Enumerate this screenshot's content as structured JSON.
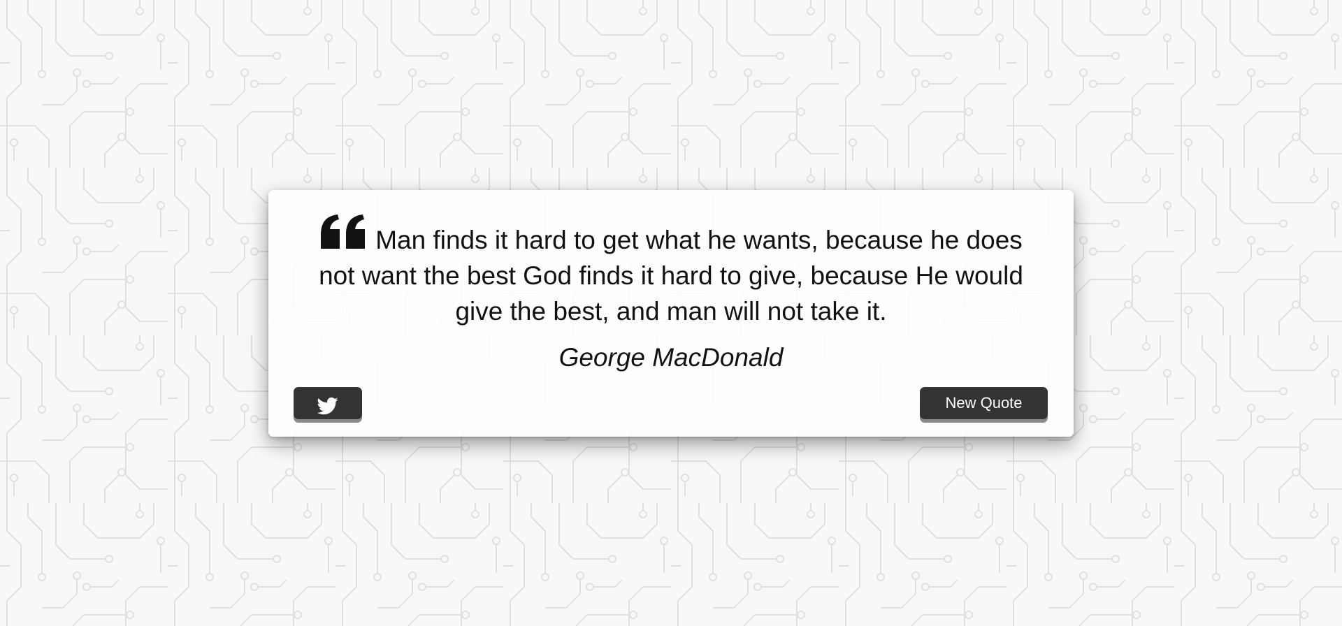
{
  "quote": {
    "text": "Man finds it hard to get what he wants, because he does not want the best God finds it hard to give, because He would give the best, and man will not take it.",
    "author": "George MacDonald",
    "icon": "quote-left-icon"
  },
  "actions": {
    "tweet_icon": "twitter-icon",
    "new_quote_label": "New Quote"
  },
  "colors": {
    "button_bg": "#333333",
    "button_text": "#ffffff",
    "text": "#111111",
    "background": "#f7f7f8",
    "circuit_lines": "#e2e2e4"
  }
}
